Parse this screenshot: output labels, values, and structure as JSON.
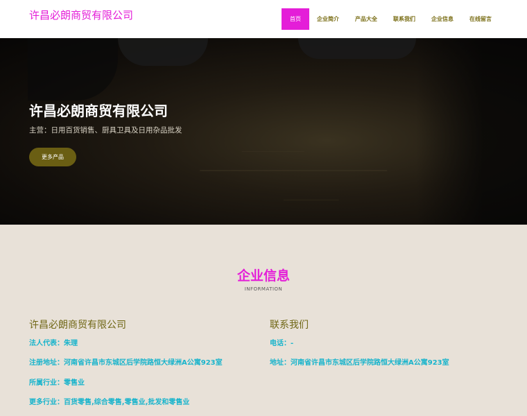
{
  "header": {
    "logo": "许昌必朗商贸有限公司",
    "nav": [
      {
        "label": "首页",
        "active": true
      },
      {
        "label": "企业简介"
      },
      {
        "label": "产品大全"
      },
      {
        "label": "联系我们"
      },
      {
        "label": "企业信息"
      },
      {
        "label": "在线留言"
      }
    ]
  },
  "hero": {
    "title": "许昌必朗商贸有限公司",
    "subtitle": "主营：日用百货销售、厨具卫具及日用杂品批发",
    "button": "更多产品"
  },
  "info": {
    "title": "企业信息",
    "subtitle": "INFORMATION",
    "left": {
      "title": "许昌必朗商贸有限公司",
      "rows": [
        "法人代表：朱理",
        "注册地址：河南省许昌市东城区后学院路恒大绿洲A公寓923室",
        "所属行业：零售业",
        "更多行业：百货零售,综合零售,零售业,批发和零售业"
      ]
    },
    "right": {
      "title": "联系我们",
      "rows": [
        "电话：-",
        "地址：河南省许昌市东城区后学院路恒大绿洲A公寓923室"
      ]
    }
  },
  "colors": {
    "accent": "#e41ed8",
    "olive": "#6f6614",
    "cyan": "#18b4cc",
    "section_bg": "#e8e1d8"
  }
}
